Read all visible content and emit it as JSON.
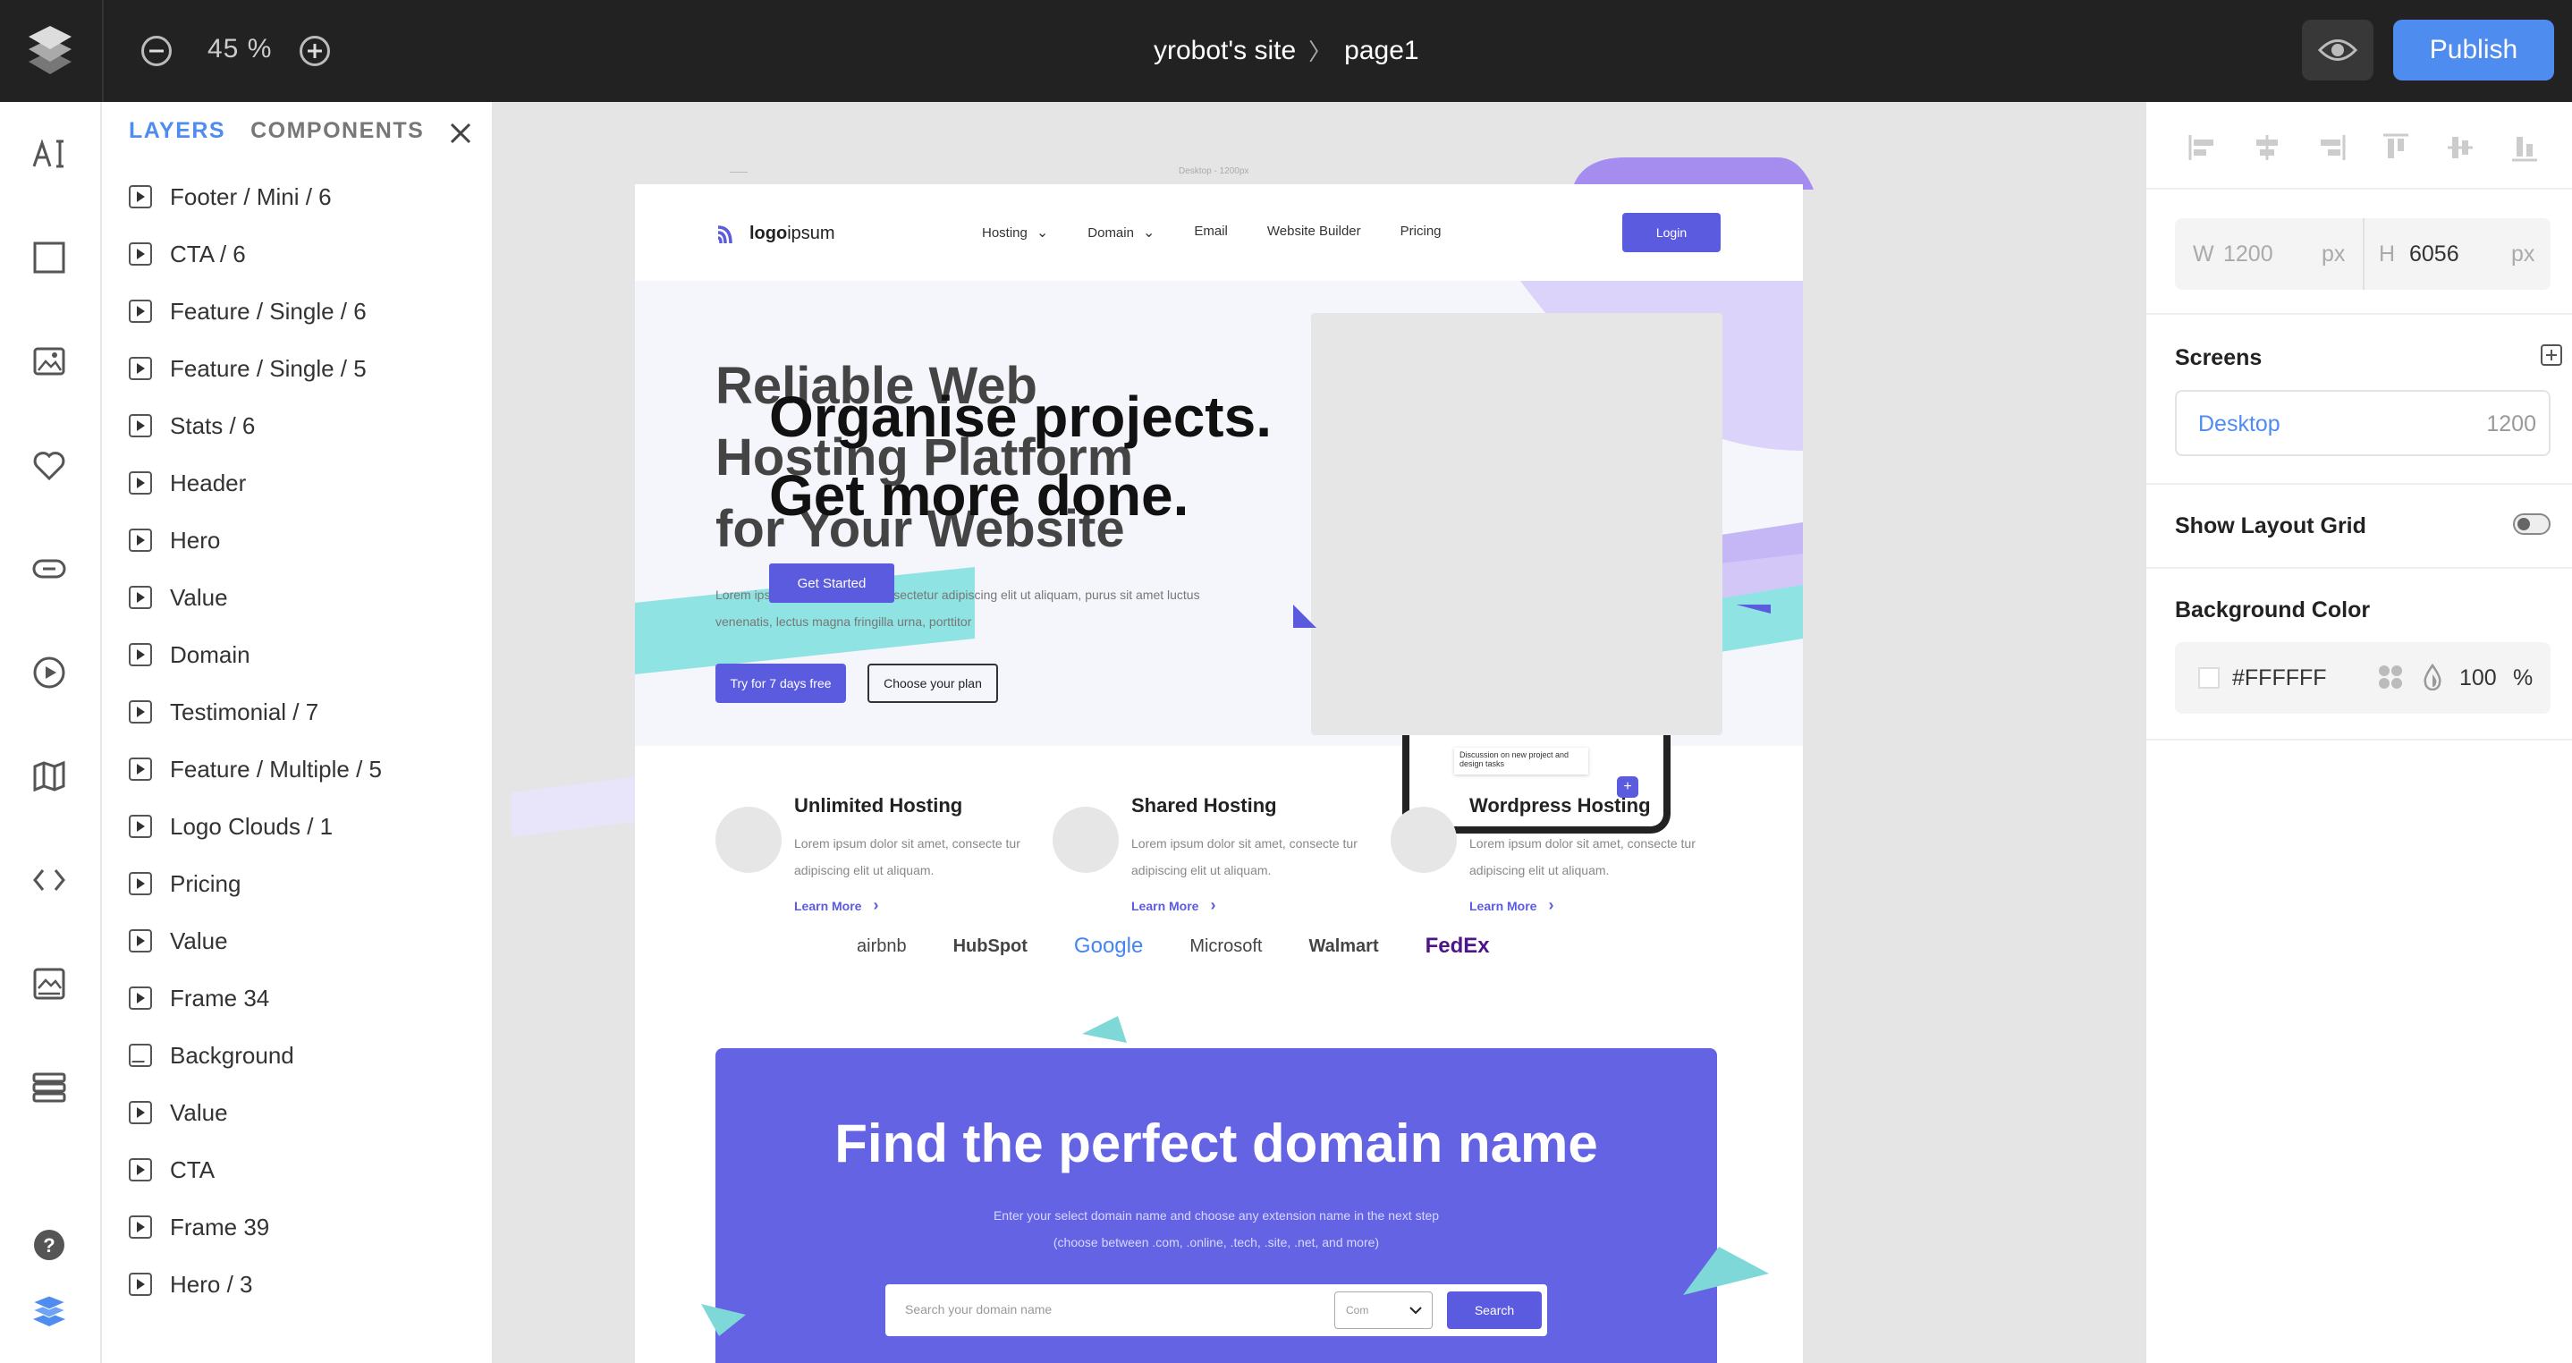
{
  "topbar": {
    "zoom": "45 %",
    "site": "yrobot's site",
    "page": "page1",
    "publish_label": "Publish"
  },
  "toolbar": {
    "tools": [
      "text-tool-icon",
      "rectangle-tool-icon",
      "image-tool-icon",
      "heart-icon",
      "button-tool-icon",
      "video-tool-icon",
      "map-icon",
      "code-icon",
      "gallery-icon",
      "list-icon"
    ],
    "help_icon": "help-icon",
    "layers_icon": "layers-icon"
  },
  "layers_panel": {
    "tab_layers": "LAYERS",
    "tab_components": "COMPONENTS",
    "items": [
      {
        "label": "Footer / Mini / 6",
        "type": "component"
      },
      {
        "label": "CTA / 6",
        "type": "component"
      },
      {
        "label": "Feature / Single / 6",
        "type": "component"
      },
      {
        "label": "Feature / Single / 5",
        "type": "component"
      },
      {
        "label": "Stats / 6",
        "type": "component"
      },
      {
        "label": "Header",
        "type": "component"
      },
      {
        "label": "Hero",
        "type": "component"
      },
      {
        "label": "Value",
        "type": "component"
      },
      {
        "label": "Domain",
        "type": "component"
      },
      {
        "label": "Testimonial / 7",
        "type": "component"
      },
      {
        "label": "Feature / Multiple / 5",
        "type": "component"
      },
      {
        "label": "Logo Clouds / 1",
        "type": "component"
      },
      {
        "label": "Pricing",
        "type": "component"
      },
      {
        "label": "Value",
        "type": "component"
      },
      {
        "label": "Frame 34",
        "type": "component"
      },
      {
        "label": "Background",
        "type": "image"
      },
      {
        "label": "Value",
        "type": "component"
      },
      {
        "label": "CTA",
        "type": "component"
      },
      {
        "label": "Frame 39",
        "type": "component"
      },
      {
        "label": "Hero / 3",
        "type": "component"
      }
    ]
  },
  "canvas": {
    "frame_label": "Desktop - 1200px",
    "nav": {
      "logo_a": "logo",
      "logo_b": "ipsum",
      "links": [
        "Hosting",
        "Domain",
        "Email",
        "Website Builder",
        "Pricing"
      ],
      "login": "Login"
    },
    "hero": {
      "title": "Reliable Web Hosting Platform for Your Website",
      "overlay_line1": "Organise projects.",
      "overlay_line2": "Get more done.",
      "get_started": "Get Started",
      "desc": "Lorem ipsum dolor sit amet, consectetur adipiscing elit ut aliquam, purus sit amet luctus venenatis, lectus magna fringilla urna, porttitor",
      "try_btn": "Try for 7 days free",
      "plan_btn": "Choose your plan"
    },
    "features": [
      {
        "title": "Unlimited Hosting",
        "desc": "Lorem ipsum dolor sit amet, consecte tur adipiscing elit ut aliquam.",
        "link": "Learn More"
      },
      {
        "title": "Shared Hosting",
        "desc": "Lorem ipsum dolor sit amet, consecte tur adipiscing elit ut aliquam.",
        "link": "Learn More"
      },
      {
        "title": "Wordpress Hosting",
        "desc": "Lorem ipsum dolor sit amet, consecte tur adipiscing elit ut aliquam.",
        "link": "Learn More"
      }
    ],
    "logos": [
      "airbnb",
      "HubSpot",
      "Google",
      "Microsoft",
      "Walmart",
      "FedEx"
    ],
    "domain": {
      "title": "Find the perfect domain name",
      "line1": "Enter your select domain name and choose any extension name in the next step",
      "line2": "(choose between .com, .online, .tech, .site, .net, and more)",
      "placeholder": "Search your domain name",
      "select": "Com",
      "search_btn": "Search"
    }
  },
  "props": {
    "w_label": "W",
    "w_value": "1200",
    "h_label": "H",
    "h_value": "6056",
    "unit": "px",
    "screens_title": "Screens",
    "screen_name": "Desktop",
    "screen_width": "1200",
    "layout_grid_label": "Show Layout Grid",
    "bg_title": "Background Color",
    "bg_hex": "#FFFFFF",
    "bg_opacity": "100",
    "bg_opacity_unit": "%"
  },
  "colors": {
    "accent": "#4f8cf0",
    "brand_purple": "#5b5be0",
    "topbar": "#222222"
  }
}
